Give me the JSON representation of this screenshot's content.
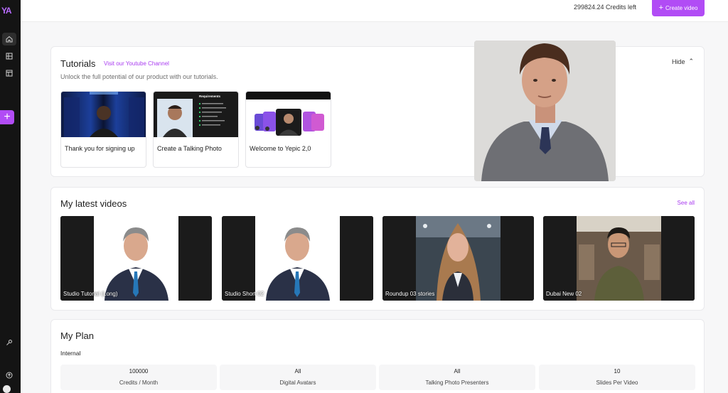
{
  "sidebar": {
    "logo": "YA",
    "icons": [
      "home-icon",
      "video-library-icon",
      "template-icon",
      "add-icon",
      "key-icon",
      "upload-icon",
      "user-icon"
    ]
  },
  "header": {
    "credits": "299824.24 Credits left",
    "create_button": "Create video"
  },
  "tutorials": {
    "title": "Tutorials",
    "youtube_link": "Visit our Youtube Channel",
    "subtitle": "Unlock the full potential of our product with our tutorials.",
    "hide_label": "Hide",
    "items": [
      {
        "label": "Thank you for signing up"
      },
      {
        "label": "Create a Talking Photo",
        "thumb_heading": "Requirements"
      },
      {
        "label": "Welcome to Yepic 2,0"
      }
    ]
  },
  "latest_videos": {
    "title": "My latest videos",
    "see_all": "See all",
    "items": [
      {
        "label": "Studio Tutorial (Long)"
      },
      {
        "label": "Studio Short 02"
      },
      {
        "label": "Roundup 03 stories"
      },
      {
        "label": "Dubai New 02"
      }
    ]
  },
  "plan": {
    "title": "My Plan",
    "tier": "Internal",
    "stats": [
      {
        "value": "100000",
        "label": "Credits / Month"
      },
      {
        "value": "All",
        "label": "Digital Avatars"
      },
      {
        "value": "All",
        "label": "Talking Photo Presenters"
      },
      {
        "value": "10",
        "label": "Slides Per Video"
      }
    ]
  },
  "colors": {
    "accent": "#b14cf5",
    "sidebar": "#141414",
    "background": "#f7f7f8"
  }
}
